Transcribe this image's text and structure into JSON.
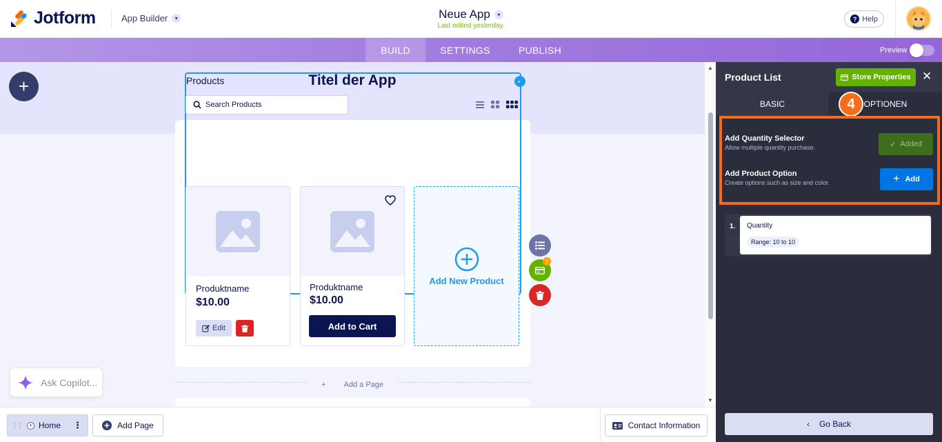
{
  "header": {
    "logo_text": "Jotform",
    "app_builder_label": "App Builder",
    "app_name": "Neue App",
    "last_edited": "Last edited yesterday.",
    "help_label": "Help"
  },
  "nav": {
    "tabs": [
      {
        "label": "BUILD",
        "active": true
      },
      {
        "label": "SETTINGS",
        "active": false
      },
      {
        "label": "PUBLISH",
        "active": false
      }
    ],
    "preview_label": "Preview"
  },
  "canvas": {
    "app_title": "Titel der App",
    "products_label": "Products",
    "search_placeholder": "Search Products",
    "products": [
      {
        "name": "Produktname",
        "price": "$10.00",
        "edit_label": "Edit"
      },
      {
        "name": "Produktname",
        "price": "$10.00",
        "cart_label": "Add to Cart"
      }
    ],
    "add_new_product": "Add New Product",
    "add_page_divider": "Add a Page",
    "copilot_label": "Ask Copilot..."
  },
  "bottombar": {
    "home_label": "Home",
    "add_page_label": "Add Page",
    "contact_label": "Contact Information"
  },
  "panel": {
    "title": "Product List",
    "store_properties_label": "Store Properties",
    "tabs": [
      {
        "label": "BASIC",
        "active": false
      },
      {
        "label": "OPTIONEN",
        "active": true
      }
    ],
    "step_number": "4",
    "options": [
      {
        "title": "Add Quantity Selector",
        "subtitle": "Allow multiple quantity purchase.",
        "button": "Added"
      },
      {
        "title": "Add Product Option",
        "subtitle": "Create options such as size and color.",
        "button": "Add"
      }
    ],
    "option_items": [
      {
        "index": "1.",
        "title": "Quantity",
        "range": "Range: 10 to 10"
      }
    ],
    "go_back_label": "Go Back"
  },
  "colors": {
    "brand_navy": "#0a1551",
    "accent_blue": "#1c9cea",
    "green": "#64b200",
    "highlight_orange": "#f56b1d"
  }
}
